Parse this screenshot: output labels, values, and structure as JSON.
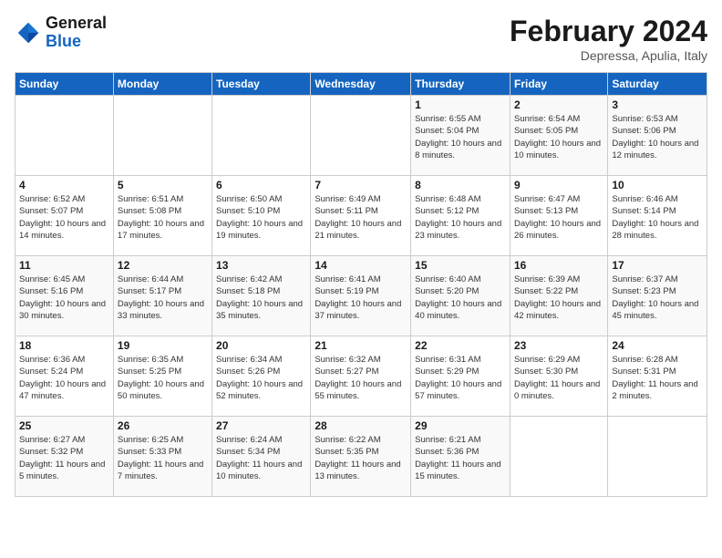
{
  "header": {
    "logo_general": "General",
    "logo_blue": "Blue",
    "title": "February 2024",
    "location": "Depressa, Apulia, Italy"
  },
  "days_of_week": [
    "Sunday",
    "Monday",
    "Tuesday",
    "Wednesday",
    "Thursday",
    "Friday",
    "Saturday"
  ],
  "weeks": [
    {
      "days": [
        {
          "number": "",
          "info": ""
        },
        {
          "number": "",
          "info": ""
        },
        {
          "number": "",
          "info": ""
        },
        {
          "number": "",
          "info": ""
        },
        {
          "number": "1",
          "info": "Sunrise: 6:55 AM\nSunset: 5:04 PM\nDaylight: 10 hours\nand 8 minutes."
        },
        {
          "number": "2",
          "info": "Sunrise: 6:54 AM\nSunset: 5:05 PM\nDaylight: 10 hours\nand 10 minutes."
        },
        {
          "number": "3",
          "info": "Sunrise: 6:53 AM\nSunset: 5:06 PM\nDaylight: 10 hours\nand 12 minutes."
        }
      ]
    },
    {
      "days": [
        {
          "number": "4",
          "info": "Sunrise: 6:52 AM\nSunset: 5:07 PM\nDaylight: 10 hours\nand 14 minutes."
        },
        {
          "number": "5",
          "info": "Sunrise: 6:51 AM\nSunset: 5:08 PM\nDaylight: 10 hours\nand 17 minutes."
        },
        {
          "number": "6",
          "info": "Sunrise: 6:50 AM\nSunset: 5:10 PM\nDaylight: 10 hours\nand 19 minutes."
        },
        {
          "number": "7",
          "info": "Sunrise: 6:49 AM\nSunset: 5:11 PM\nDaylight: 10 hours\nand 21 minutes."
        },
        {
          "number": "8",
          "info": "Sunrise: 6:48 AM\nSunset: 5:12 PM\nDaylight: 10 hours\nand 23 minutes."
        },
        {
          "number": "9",
          "info": "Sunrise: 6:47 AM\nSunset: 5:13 PM\nDaylight: 10 hours\nand 26 minutes."
        },
        {
          "number": "10",
          "info": "Sunrise: 6:46 AM\nSunset: 5:14 PM\nDaylight: 10 hours\nand 28 minutes."
        }
      ]
    },
    {
      "days": [
        {
          "number": "11",
          "info": "Sunrise: 6:45 AM\nSunset: 5:16 PM\nDaylight: 10 hours\nand 30 minutes."
        },
        {
          "number": "12",
          "info": "Sunrise: 6:44 AM\nSunset: 5:17 PM\nDaylight: 10 hours\nand 33 minutes."
        },
        {
          "number": "13",
          "info": "Sunrise: 6:42 AM\nSunset: 5:18 PM\nDaylight: 10 hours\nand 35 minutes."
        },
        {
          "number": "14",
          "info": "Sunrise: 6:41 AM\nSunset: 5:19 PM\nDaylight: 10 hours\nand 37 minutes."
        },
        {
          "number": "15",
          "info": "Sunrise: 6:40 AM\nSunset: 5:20 PM\nDaylight: 10 hours\nand 40 minutes."
        },
        {
          "number": "16",
          "info": "Sunrise: 6:39 AM\nSunset: 5:22 PM\nDaylight: 10 hours\nand 42 minutes."
        },
        {
          "number": "17",
          "info": "Sunrise: 6:37 AM\nSunset: 5:23 PM\nDaylight: 10 hours\nand 45 minutes."
        }
      ]
    },
    {
      "days": [
        {
          "number": "18",
          "info": "Sunrise: 6:36 AM\nSunset: 5:24 PM\nDaylight: 10 hours\nand 47 minutes."
        },
        {
          "number": "19",
          "info": "Sunrise: 6:35 AM\nSunset: 5:25 PM\nDaylight: 10 hours\nand 50 minutes."
        },
        {
          "number": "20",
          "info": "Sunrise: 6:34 AM\nSunset: 5:26 PM\nDaylight: 10 hours\nand 52 minutes."
        },
        {
          "number": "21",
          "info": "Sunrise: 6:32 AM\nSunset: 5:27 PM\nDaylight: 10 hours\nand 55 minutes."
        },
        {
          "number": "22",
          "info": "Sunrise: 6:31 AM\nSunset: 5:29 PM\nDaylight: 10 hours\nand 57 minutes."
        },
        {
          "number": "23",
          "info": "Sunrise: 6:29 AM\nSunset: 5:30 PM\nDaylight: 11 hours\nand 0 minutes."
        },
        {
          "number": "24",
          "info": "Sunrise: 6:28 AM\nSunset: 5:31 PM\nDaylight: 11 hours\nand 2 minutes."
        }
      ]
    },
    {
      "days": [
        {
          "number": "25",
          "info": "Sunrise: 6:27 AM\nSunset: 5:32 PM\nDaylight: 11 hours\nand 5 minutes."
        },
        {
          "number": "26",
          "info": "Sunrise: 6:25 AM\nSunset: 5:33 PM\nDaylight: 11 hours\nand 7 minutes."
        },
        {
          "number": "27",
          "info": "Sunrise: 6:24 AM\nSunset: 5:34 PM\nDaylight: 11 hours\nand 10 minutes."
        },
        {
          "number": "28",
          "info": "Sunrise: 6:22 AM\nSunset: 5:35 PM\nDaylight: 11 hours\nand 13 minutes."
        },
        {
          "number": "29",
          "info": "Sunrise: 6:21 AM\nSunset: 5:36 PM\nDaylight: 11 hours\nand 15 minutes."
        },
        {
          "number": "",
          "info": ""
        },
        {
          "number": "",
          "info": ""
        }
      ]
    }
  ]
}
